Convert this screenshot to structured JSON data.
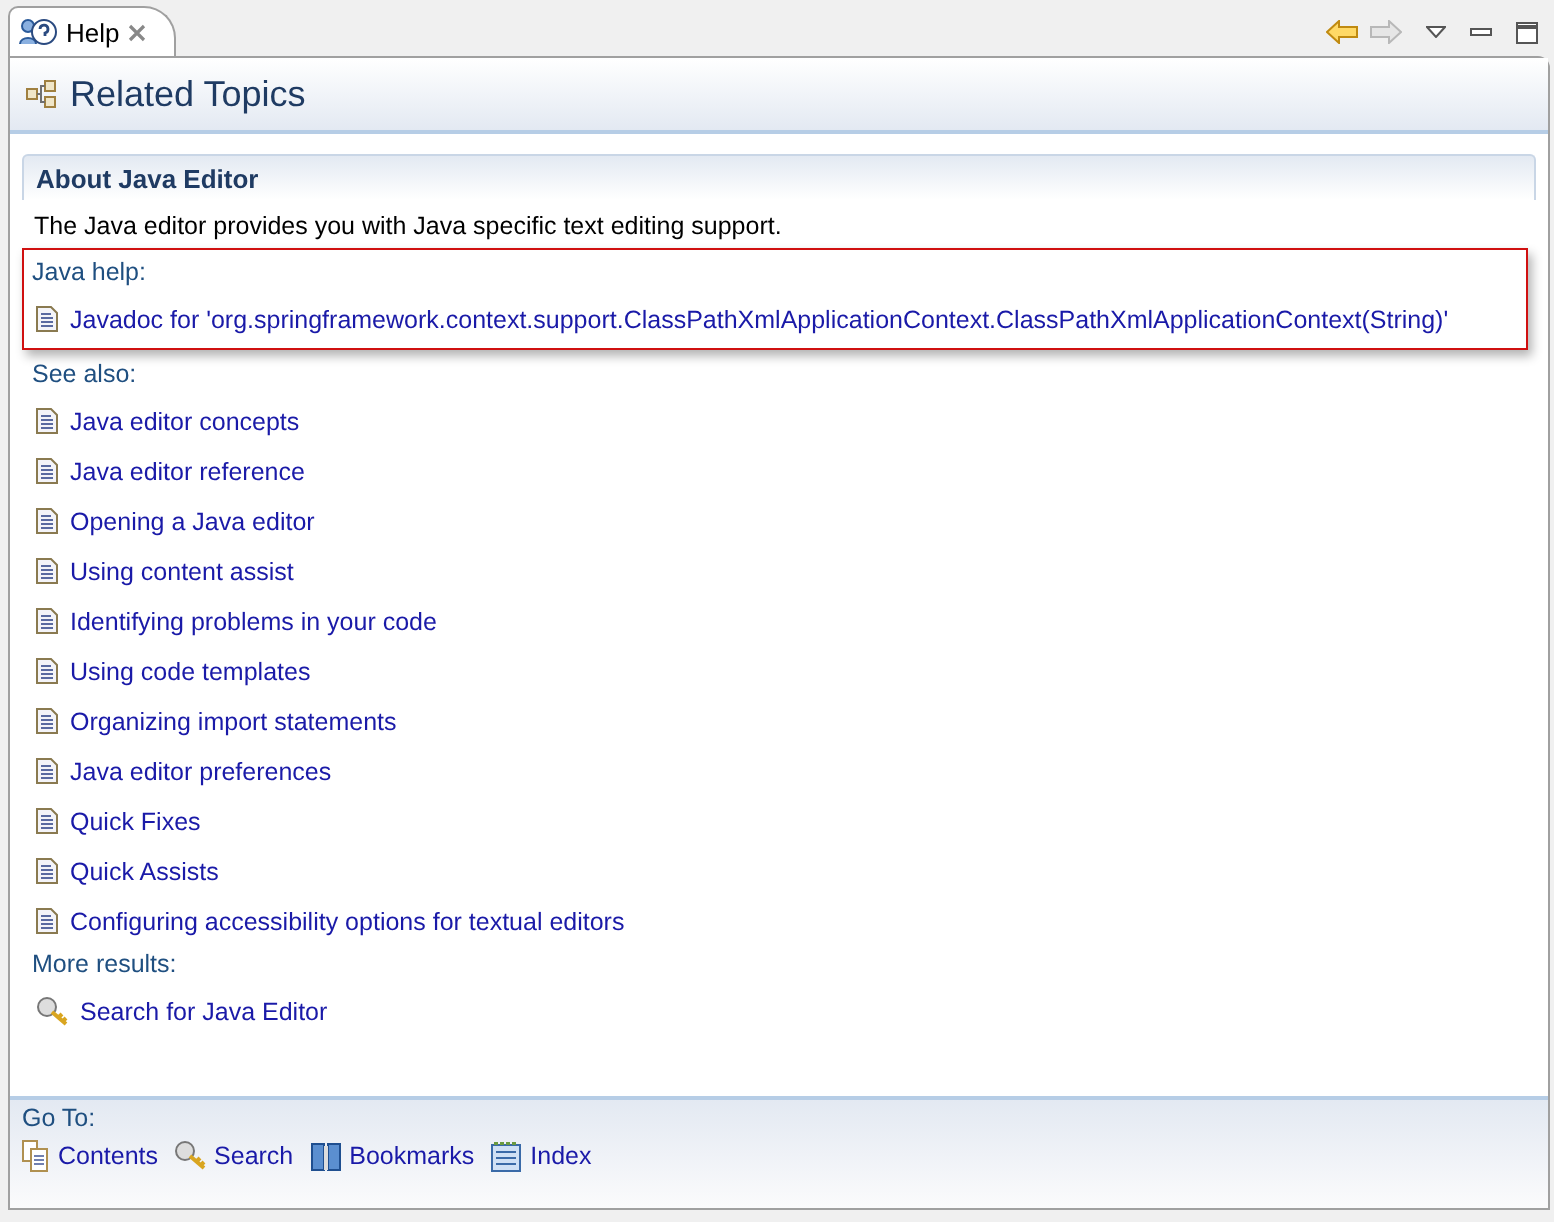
{
  "tab": {
    "title": "Help",
    "selected": true
  },
  "navigation": {
    "back_disabled": false,
    "forward_disabled": true
  },
  "header": {
    "title": "Related Topics"
  },
  "section": {
    "title": "About Java Editor",
    "description": "The Java editor provides you with Java specific text editing support.",
    "java_help": {
      "label": "Java help:",
      "highlighted": true,
      "links": [
        "Javadoc for 'org.springframework.context.support.ClassPathXmlApplicationContext.ClassPathXmlApplicationContext(String)'"
      ]
    },
    "see_also": {
      "label": "See also:",
      "links": [
        "Java editor concepts",
        "Java editor reference",
        "Opening a Java editor",
        "Using content assist",
        "Identifying problems in your code",
        "Using code templates",
        "Organizing import statements",
        "Java editor preferences",
        "Quick Fixes",
        "Quick Assists",
        "Configuring accessibility options for textual editors"
      ]
    },
    "more_results": {
      "label": "More results:",
      "links": [
        "Search for Java Editor"
      ]
    }
  },
  "go_to": {
    "label": "Go To:",
    "links": [
      {
        "kind": "contents",
        "label": "Contents"
      },
      {
        "kind": "search",
        "label": "Search"
      },
      {
        "kind": "bookmarks",
        "label": "Bookmarks"
      },
      {
        "kind": "index",
        "label": "Index"
      }
    ]
  }
}
